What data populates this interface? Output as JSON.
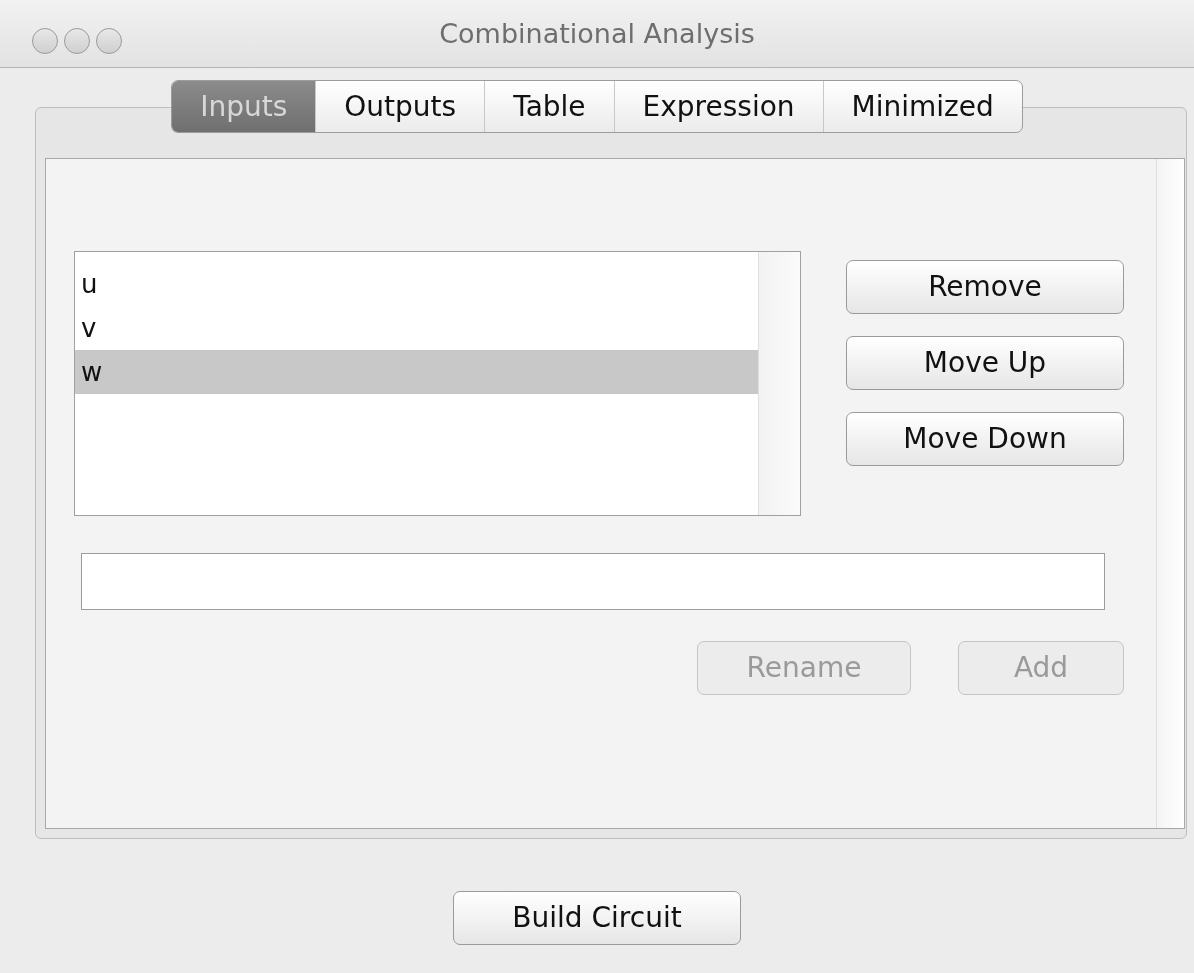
{
  "window": {
    "title": "Combinational Analysis"
  },
  "tabs": [
    {
      "label": "Inputs",
      "selected": true
    },
    {
      "label": "Outputs",
      "selected": false
    },
    {
      "label": "Table",
      "selected": false
    },
    {
      "label": "Expression",
      "selected": false
    },
    {
      "label": "Minimized",
      "selected": false
    }
  ],
  "inputs_list": {
    "items": [
      {
        "label": "u",
        "selected": false
      },
      {
        "label": "v",
        "selected": false
      },
      {
        "label": "w",
        "selected": true
      }
    ]
  },
  "side_buttons": [
    {
      "label": "Remove",
      "disabled": false
    },
    {
      "label": "Move Up",
      "disabled": false
    },
    {
      "label": "Move Down",
      "disabled": false
    }
  ],
  "field_buttons": [
    {
      "label": "Rename",
      "disabled": true
    },
    {
      "label": "Add",
      "disabled": true
    }
  ],
  "footer_button": {
    "label": "Build Circuit",
    "disabled": false
  }
}
